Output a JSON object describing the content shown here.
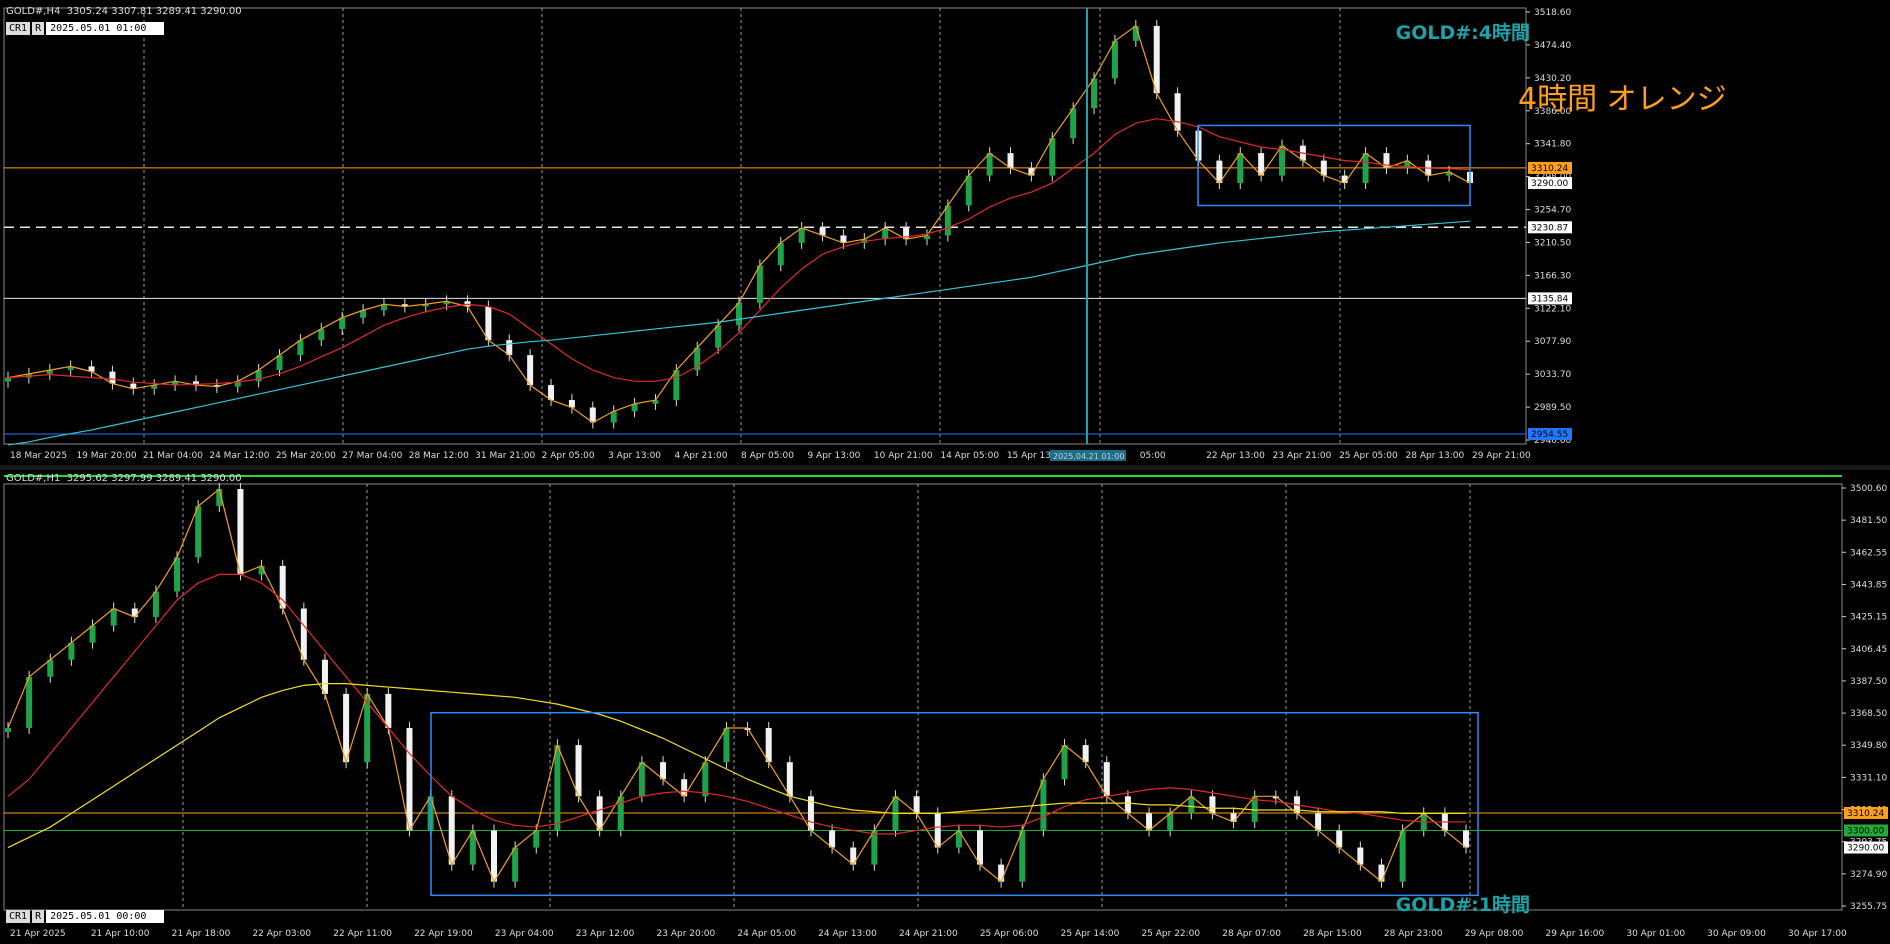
{
  "top": {
    "info": "GOLD#,H4  3305.24 3307.81 3289.41 3290.00",
    "toolbar": [
      "CR1",
      "R"
    ],
    "time": "2025.05.01 01:00",
    "label": "GOLD#:4時間",
    "annotation": "4時間  オレンジ",
    "price_ticks": [
      "3518.60",
      "3474.40",
      "3430.20",
      "3386.00",
      "3341.80",
      "3298.00",
      "3254.70",
      "3210.50",
      "3166.30",
      "3122.10",
      "3077.90",
      "3033.70",
      "2989.50",
      "2946.60"
    ],
    "price_tags": [
      {
        "text": "3310.24",
        "color": "#ff9f1c"
      },
      {
        "text": "3290.00",
        "color": "#ffffff"
      },
      {
        "text": "3230.87",
        "color": "#ffffff"
      },
      {
        "text": "3135.84",
        "color": "#ffffff"
      },
      {
        "text": "2954.55",
        "color": "#2277ff"
      }
    ],
    "time_ticks": [
      "18 Mar 2025",
      "19 Mar 20:00",
      "21 Mar 04:00",
      "24 Mar 12:00",
      "25 Mar 20:00",
      "27 Mar 04:00",
      "28 Mar 12:00",
      "31 Mar 21:00",
      "2 Apr 05:00",
      "3 Apr 13:00",
      "4 Apr 21:00",
      "8 Apr 05:00",
      "9 Apr 13:00",
      "10 Apr 21:00",
      "14 Apr 05:00",
      "15 Apr 13:00",
      "16 A",
      "05:00",
      "22 Apr 13:00",
      "23 Apr 21:00",
      "25 Apr 05:00",
      "28 Apr 13:00",
      "29 Apr 21:00"
    ],
    "cursor_time": "2025.04.21 01:00"
  },
  "bottom": {
    "info": "GOLD#,H1  3295.62 3297.99 3289.41 3290.00",
    "toolbar": [
      "CR1",
      "R"
    ],
    "time": "2025.05.01 00:00",
    "label": "GOLD#:1時間",
    "price_ticks": [
      "3500.60",
      "3481.50",
      "3462.55",
      "3443.85",
      "3425.15",
      "3406.45",
      "3387.50",
      "3368.50",
      "3349.80",
      "3331.10",
      "3312.40",
      "3293.75",
      "3274.90",
      "3255.75"
    ],
    "price_tags": [
      {
        "text": "3310.24",
        "color": "#ff9f1c"
      },
      {
        "text": "3300.00",
        "color": "#1faa3a"
      },
      {
        "text": "3290.00",
        "color": "#ffffff"
      }
    ],
    "time_ticks": [
      "21 Apr 2025",
      "21 Apr 10:00",
      "21 Apr 18:00",
      "22 Apr 03:00",
      "22 Apr 11:00",
      "22 Apr 19:00",
      "23 Apr 04:00",
      "23 Apr 12:00",
      "23 Apr 20:00",
      "24 Apr 05:00",
      "24 Apr 13:00",
      "24 Apr 21:00",
      "25 Apr 06:00",
      "25 Apr 14:00",
      "25 Apr 22:00",
      "28 Apr 07:00",
      "28 Apr 15:00",
      "28 Apr 23:00",
      "29 Apr 08:00",
      "29 Apr 16:00",
      "30 Apr 01:00",
      "30 Apr 09:00",
      "30 Apr 17:00"
    ]
  },
  "chart_data": [
    {
      "type": "line",
      "title": "GOLD#,H4",
      "ylim": [
        2946.6,
        3518.6
      ],
      "series": [
        {
          "key": "close",
          "color": "#1fa34a",
          "values": [
            3030,
            3035,
            3040,
            3045,
            3038,
            3022,
            3015,
            3020,
            3025,
            3020,
            3018,
            3025,
            3040,
            3060,
            3080,
            3095,
            3110,
            3120,
            3128,
            3125,
            3128,
            3132,
            3125,
            3080,
            3060,
            3020,
            3000,
            2990,
            2970,
            2985,
            2995,
            3000,
            3040,
            3070,
            3100,
            3130,
            3180,
            3210,
            3230,
            3220,
            3210,
            3215,
            3230,
            3215,
            3220,
            3260,
            3300,
            3330,
            3310,
            3300,
            3350,
            3390,
            3430,
            3480,
            3500,
            3410,
            3360,
            3320,
            3290,
            3330,
            3300,
            3340,
            3320,
            3300,
            3290,
            3330,
            3310,
            3320,
            3300,
            3305,
            3290
          ]
        },
        {
          "key": "ma-red",
          "color": "#e02a2a",
          "values": [
            3030,
            3032,
            3034,
            3032,
            3030,
            3028,
            3024,
            3022,
            3020,
            3021,
            3022,
            3024,
            3028,
            3035,
            3045,
            3058,
            3070,
            3085,
            3100,
            3110,
            3118,
            3124,
            3128,
            3125,
            3115,
            3095,
            3075,
            3055,
            3040,
            3030,
            3025,
            3025,
            3030,
            3045,
            3065,
            3090,
            3120,
            3150,
            3175,
            3195,
            3205,
            3212,
            3216,
            3218,
            3222,
            3230,
            3242,
            3258,
            3270,
            3278,
            3290,
            3310,
            3330,
            3355,
            3370,
            3376,
            3372,
            3365,
            3352,
            3345,
            3338,
            3335,
            3330,
            3325,
            3320,
            3318,
            3314,
            3312,
            3310,
            3309,
            3308
          ]
        },
        {
          "key": "ma-cyan",
          "color": "#35c7d6",
          "values": [
            2940,
            2944,
            2950,
            2955,
            2960,
            2966,
            2972,
            2978,
            2984,
            2990,
            2996,
            3002,
            3008,
            3014,
            3020,
            3026,
            3032,
            3038,
            3044,
            3050,
            3056,
            3062,
            3068,
            3072,
            3075,
            3078,
            3080,
            3083,
            3086,
            3089,
            3092,
            3095,
            3098,
            3101,
            3104,
            3108,
            3112,
            3116,
            3120,
            3124,
            3128,
            3132,
            3136,
            3140,
            3144,
            3148,
            3152,
            3156,
            3160,
            3164,
            3170,
            3176,
            3182,
            3188,
            3194,
            3198,
            3202,
            3206,
            3210,
            3213,
            3216,
            3219,
            3222,
            3225,
            3227,
            3229,
            3231,
            3233,
            3235,
            3237,
            3239
          ]
        }
      ]
    },
    {
      "type": "line",
      "title": "GOLD#,H1",
      "ylim": [
        3255.75,
        3500.6
      ],
      "series": [
        {
          "key": "close",
          "color": "#1fa34a",
          "values": [
            3360,
            3390,
            3400,
            3410,
            3420,
            3430,
            3425,
            3440,
            3460,
            3490,
            3500,
            3450,
            3455,
            3430,
            3400,
            3380,
            3340,
            3380,
            3360,
            3300,
            3320,
            3280,
            3300,
            3270,
            3290,
            3300,
            3350,
            3320,
            3300,
            3320,
            3340,
            3330,
            3320,
            3340,
            3360,
            3360,
            3340,
            3320,
            3300,
            3290,
            3280,
            3300,
            3320,
            3310,
            3290,
            3300,
            3280,
            3270,
            3300,
            3330,
            3350,
            3340,
            3320,
            3310,
            3300,
            3310,
            3320,
            3310,
            3305,
            3320,
            3320,
            3310,
            3300,
            3290,
            3280,
            3270,
            3300,
            3310,
            3300,
            3290
          ]
        },
        {
          "key": "ma-red",
          "color": "#e02a2a",
          "values": [
            3320,
            3330,
            3345,
            3360,
            3375,
            3390,
            3405,
            3420,
            3435,
            3445,
            3450,
            3450,
            3445,
            3435,
            3420,
            3405,
            3390,
            3375,
            3360,
            3345,
            3332,
            3320,
            3312,
            3306,
            3303,
            3302,
            3304,
            3308,
            3312,
            3316,
            3320,
            3322,
            3323,
            3322,
            3320,
            3317,
            3313,
            3309,
            3305,
            3302,
            3300,
            3298,
            3298,
            3300,
            3302,
            3303,
            3303,
            3302,
            3303,
            3308,
            3314,
            3318,
            3320,
            3322,
            3324,
            3325,
            3324,
            3322,
            3320,
            3318,
            3317,
            3315,
            3313,
            3311,
            3310,
            3308,
            3306,
            3305,
            3305,
            3305
          ]
        },
        {
          "key": "ma-yellow",
          "color": "#f0e020",
          "values": [
            3290,
            3296,
            3302,
            3310,
            3318,
            3326,
            3334,
            3342,
            3350,
            3358,
            3366,
            3372,
            3378,
            3382,
            3385,
            3386,
            3386,
            3385,
            3384,
            3383,
            3382,
            3381,
            3380,
            3379,
            3378,
            3376,
            3374,
            3371,
            3368,
            3364,
            3359,
            3354,
            3348,
            3342,
            3336,
            3330,
            3325,
            3320,
            3317,
            3314,
            3312,
            3311,
            3310,
            3310,
            3310,
            3311,
            3312,
            3313,
            3314,
            3315,
            3316,
            3316,
            3316,
            3316,
            3315,
            3315,
            3314,
            3313,
            3313,
            3312,
            3312,
            3312,
            3311,
            3311,
            3311,
            3311,
            3310,
            3310,
            3310,
            3310
          ]
        }
      ]
    }
  ]
}
